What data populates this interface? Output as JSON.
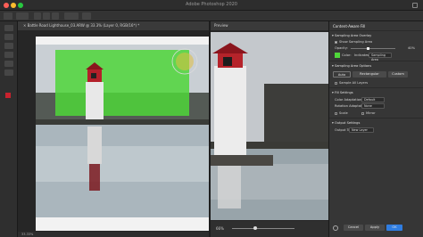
{
  "window": {
    "title": "Adobe Photoshop 2020"
  },
  "document": {
    "tab_title": "×  Battle Road Lighthouse_03.ARW @ 33.3% (Layer 0, RGB/16*) *",
    "zoom": "33.33%"
  },
  "preview": {
    "tab_label": "Preview",
    "zoom": "66%"
  },
  "panel": {
    "title": "Content-Aware Fill",
    "sampling_area_options_label": "Sampling Area Overlay",
    "show_sampling_area_label": "Show Sampling Area",
    "opacity_label": "Opacity:",
    "opacity_value": "40%",
    "color_label": "Color:",
    "indicates_label": "Indicates:",
    "indicates_value": "Sampling Area",
    "sampling_area_options_title": "Sampling Area Options",
    "buttons": {
      "auto": "Auto",
      "rectangular": "Rectangular",
      "custom": "Custom"
    },
    "sample_all_layers": "Sample All Layers",
    "fill_settings_title": "Fill Settings",
    "color_adaptation_label": "Color Adaptation:",
    "color_adaptation_value": "Default",
    "rotation_adaptation_label": "Rotation Adaptation:",
    "rotation_adaptation_value": "None",
    "scale_label": "Scale",
    "mirror_label": "Mirror",
    "output_settings_title": "Output Settings",
    "output_to_label": "Output To:",
    "output_to_value": "New Layer",
    "cancel": "Cancel",
    "apply": "Apply",
    "ok": "OK"
  },
  "colors": {
    "accent": "#2f7de1",
    "overlay": "#5cd63a",
    "lighthouse_roof": "#c0232a"
  }
}
